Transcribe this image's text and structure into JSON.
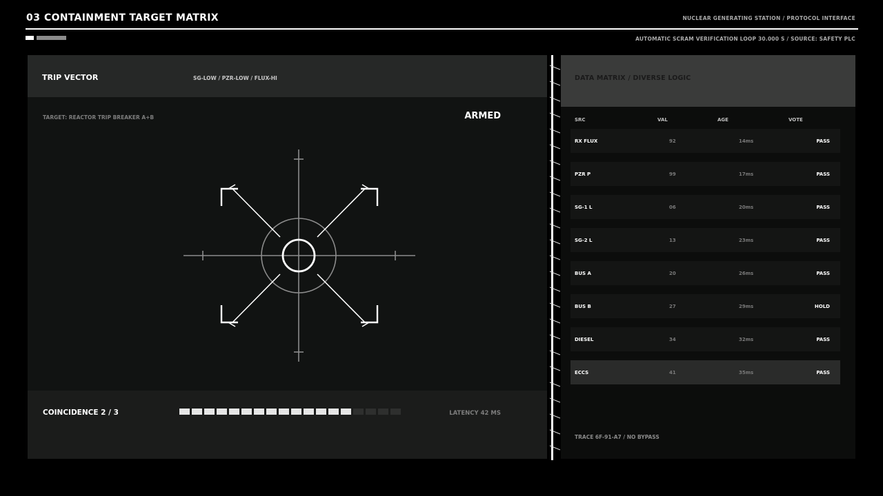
{
  "header": {
    "number": "03",
    "title": "CONTAINMENT TARGET MATRIX",
    "right_title": "NUCLEAR GENERATING STATION / PROTOCOL INTERFACE",
    "subline": "AUTOMATIC SCRAM VERIFICATION  LOOP 30.000 S  /  SOURCE: SAFETY PLC"
  },
  "trip_vector": {
    "title": "TRIP VECTOR",
    "logic": "SG-LOW / PZR-LOW / FLUX-HI",
    "target": "TARGET: REACTOR TRIP BREAKER A+B",
    "status": "ARMED",
    "coincidence_label": "COINCIDENCE  2 / 3",
    "segments_total": 18,
    "segments_filled": 14,
    "latency": "LATENCY  42 MS"
  },
  "matrix": {
    "title": "DATA MATRIX / DIVERSE LOGIC",
    "columns": [
      "SRC",
      "VAL",
      "AGE",
      "VOTE"
    ],
    "rows": [
      {
        "src": "RX FLUX",
        "val": "92",
        "age": "14ms",
        "vote": "PASS"
      },
      {
        "src": "PZR P",
        "val": "99",
        "age": "17ms",
        "vote": "PASS"
      },
      {
        "src": "SG-1 L",
        "val": "06",
        "age": "20ms",
        "vote": "PASS"
      },
      {
        "src": "SG-2 L",
        "val": "13",
        "age": "23ms",
        "vote": "PASS"
      },
      {
        "src": "BUS A",
        "val": "20",
        "age": "26ms",
        "vote": "PASS"
      },
      {
        "src": "BUS B",
        "val": "27",
        "age": "29ms",
        "vote": "HOLD"
      },
      {
        "src": "DIESEL",
        "val": "34",
        "age": "32ms",
        "vote": "PASS"
      },
      {
        "src": "ECCS",
        "val": "41",
        "age": "35ms",
        "vote": "PASS"
      }
    ],
    "highlighted_row": 7,
    "trace": "TRACE  6F-91-A7 / NO BYPASS"
  },
  "colors": {
    "background": "#000000",
    "panel": "#111312",
    "segment_on": "#e6e6e6",
    "segment_off": "#2e2f2e"
  }
}
